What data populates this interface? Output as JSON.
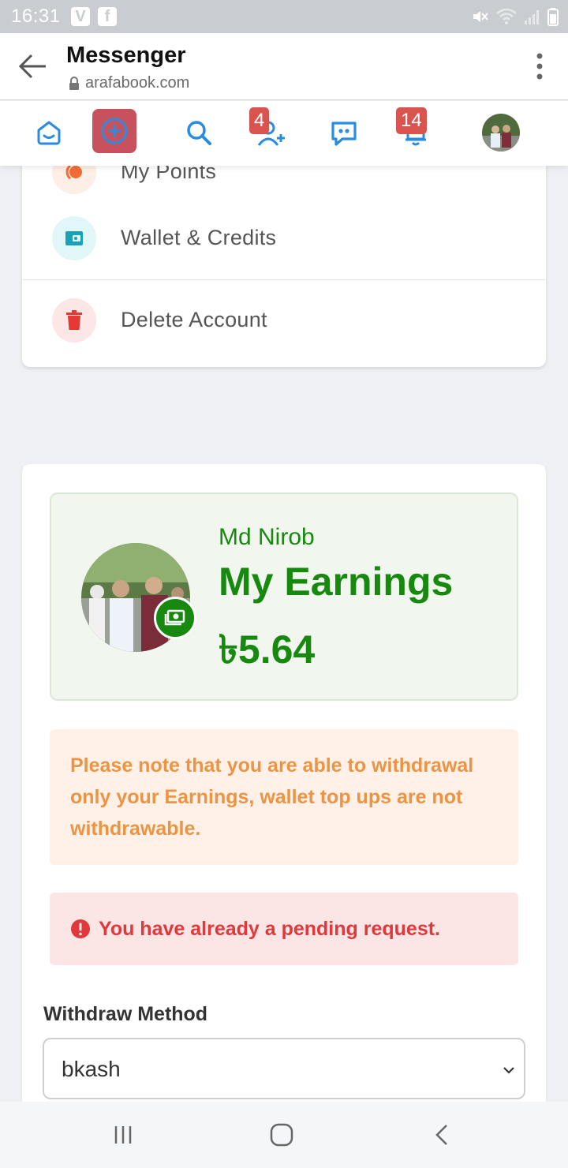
{
  "status_bar": {
    "time": "16:31",
    "app_icons": [
      "V",
      "f"
    ]
  },
  "browser": {
    "title": "Messenger",
    "url": "arafabook.com"
  },
  "nav": {
    "friend_requests_badge": "4",
    "notifications_badge": "14",
    "accent_color": "#2a8ce0",
    "create_color": "#c8515e"
  },
  "menu": {
    "items": [
      {
        "label": "My Points",
        "icon": "points-icon"
      },
      {
        "label": "Wallet & Credits",
        "icon": "wallet-icon"
      },
      {
        "label": "Delete Account",
        "icon": "trash-icon"
      }
    ]
  },
  "earnings": {
    "user_name": "Md Nirob",
    "title": "My Earnings",
    "amount": "৳5.64",
    "color": "#17890e"
  },
  "notice": {
    "text": "Please note that you are able to withdrawal only your Earnings, wallet top ups are not withdrawable."
  },
  "pending": {
    "text": "You have already a pending request."
  },
  "withdraw": {
    "label": "Withdraw Method",
    "selected": "bkash"
  }
}
